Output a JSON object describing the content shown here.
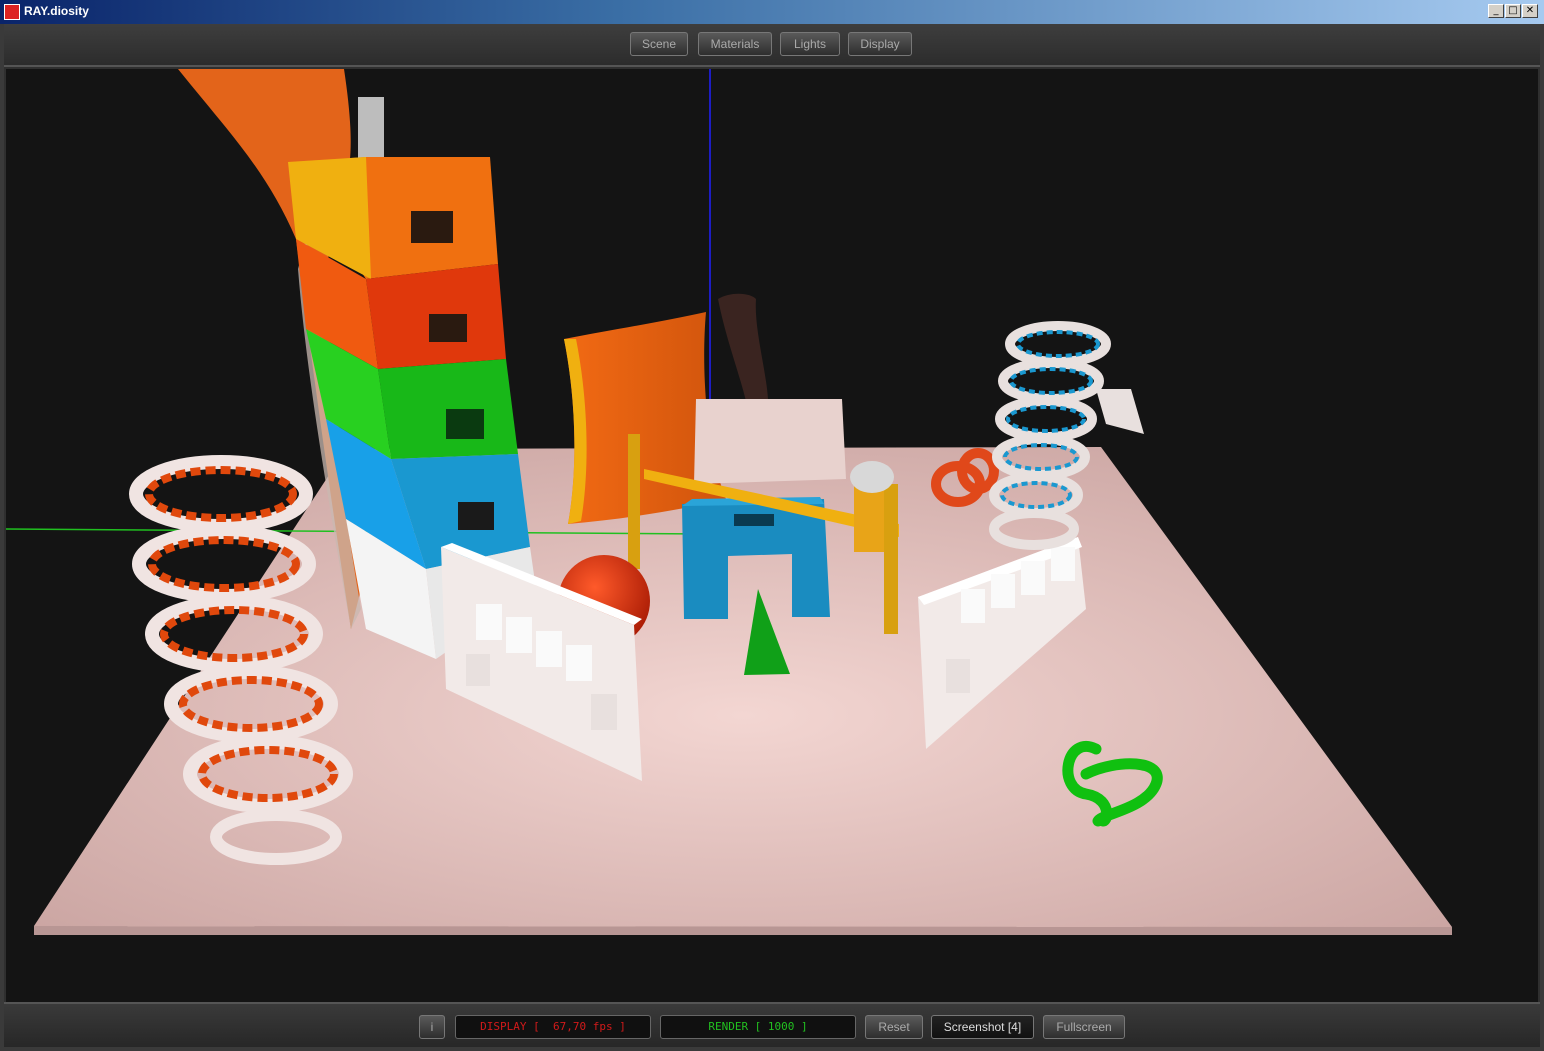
{
  "window": {
    "title": "RAY.diosity",
    "minimize": "_",
    "maximize": "□",
    "close": "✕"
  },
  "toolbar": {
    "tabs": [
      "Scene",
      "Materials",
      "Lights",
      "Display"
    ]
  },
  "statusbar": {
    "info_button": "i",
    "display_readout": "DISPLAY [  67,70 fps ]",
    "render_readout": "RENDER [ 1000 ]",
    "reset_label": "Reset",
    "screenshot_label": "Screenshot [4]",
    "fullscreen_label": "Fullscreen"
  },
  "colors": {
    "display_text": "#d21a1a",
    "render_text": "#22c020",
    "axis_y": "#2020ff",
    "axis_x": "#20c020",
    "floor": "#e8c4c0",
    "orange": "#e85a10",
    "red": "#e03a10",
    "green": "#10b818",
    "cyan": "#1a9ad8",
    "yellow": "#f0b010"
  }
}
